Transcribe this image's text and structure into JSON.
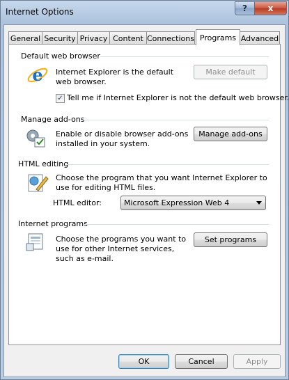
{
  "window": {
    "title": "Internet Options",
    "help_glyph": "?",
    "close_glyph": "x"
  },
  "tabs": [
    {
      "label": "General"
    },
    {
      "label": "Security"
    },
    {
      "label": "Privacy"
    },
    {
      "label": "Content"
    },
    {
      "label": "Connections"
    },
    {
      "label": "Programs",
      "active": true
    },
    {
      "label": "Advanced"
    }
  ],
  "default_browser": {
    "section_title": "Default web browser",
    "description": "Internet Explorer is the default web browser.",
    "button_label": "Make default",
    "checkbox_label": "Tell me if Internet Explorer is not the default web browser.",
    "checkbox_checked": true,
    "checkbox_glyph": "✓",
    "icon": "internet-explorer-icon"
  },
  "addons": {
    "section_title": "Manage add-ons",
    "description": "Enable or disable browser add-ons installed in your system.",
    "button_label": "Manage add-ons",
    "icon": "addons-gear-icon"
  },
  "html_editing": {
    "section_title": "HTML editing",
    "description": "Choose the program that you want Internet Explorer to use for editing HTML files.",
    "editor_label": "HTML editor:",
    "editor_value": "Microsoft Expression Web 4",
    "icon": "html-edit-icon"
  },
  "internet_programs": {
    "section_title": "Internet programs",
    "description": "Choose the programs you want to use for other Internet services, such as e-mail.",
    "button_label": "Set programs",
    "icon": "programs-icon"
  },
  "footer": {
    "ok_label": "OK",
    "cancel_label": "Cancel",
    "apply_label": "Apply"
  },
  "colors": {
    "title_bar": "#aec4de",
    "panel_bg": "#ffffff",
    "close_red": "#c9553f"
  }
}
